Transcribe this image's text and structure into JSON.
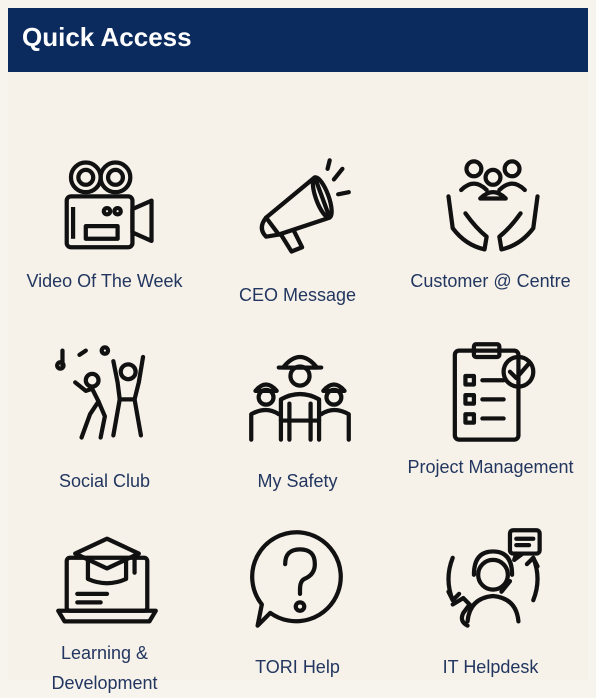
{
  "header": {
    "title": "Quick Access"
  },
  "tiles": [
    {
      "label": "Video Of The Week",
      "icon": "video-camera-icon"
    },
    {
      "label": "CEO Message",
      "icon": "megaphone-icon"
    },
    {
      "label": "Customer @ Centre",
      "icon": "customer-hands-icon"
    },
    {
      "label": "Social Club",
      "icon": "dancing-people-icon"
    },
    {
      "label": "My Safety",
      "icon": "safety-workers-icon"
    },
    {
      "label": "Project Management",
      "icon": "clipboard-check-icon"
    },
    {
      "label": "Learning & Development",
      "icon": "laptop-graduation-cap-icon"
    },
    {
      "label": "TORI Help",
      "icon": "question-bubble-icon"
    },
    {
      "label": "IT Helpdesk",
      "icon": "headset-support-icon"
    }
  ]
}
